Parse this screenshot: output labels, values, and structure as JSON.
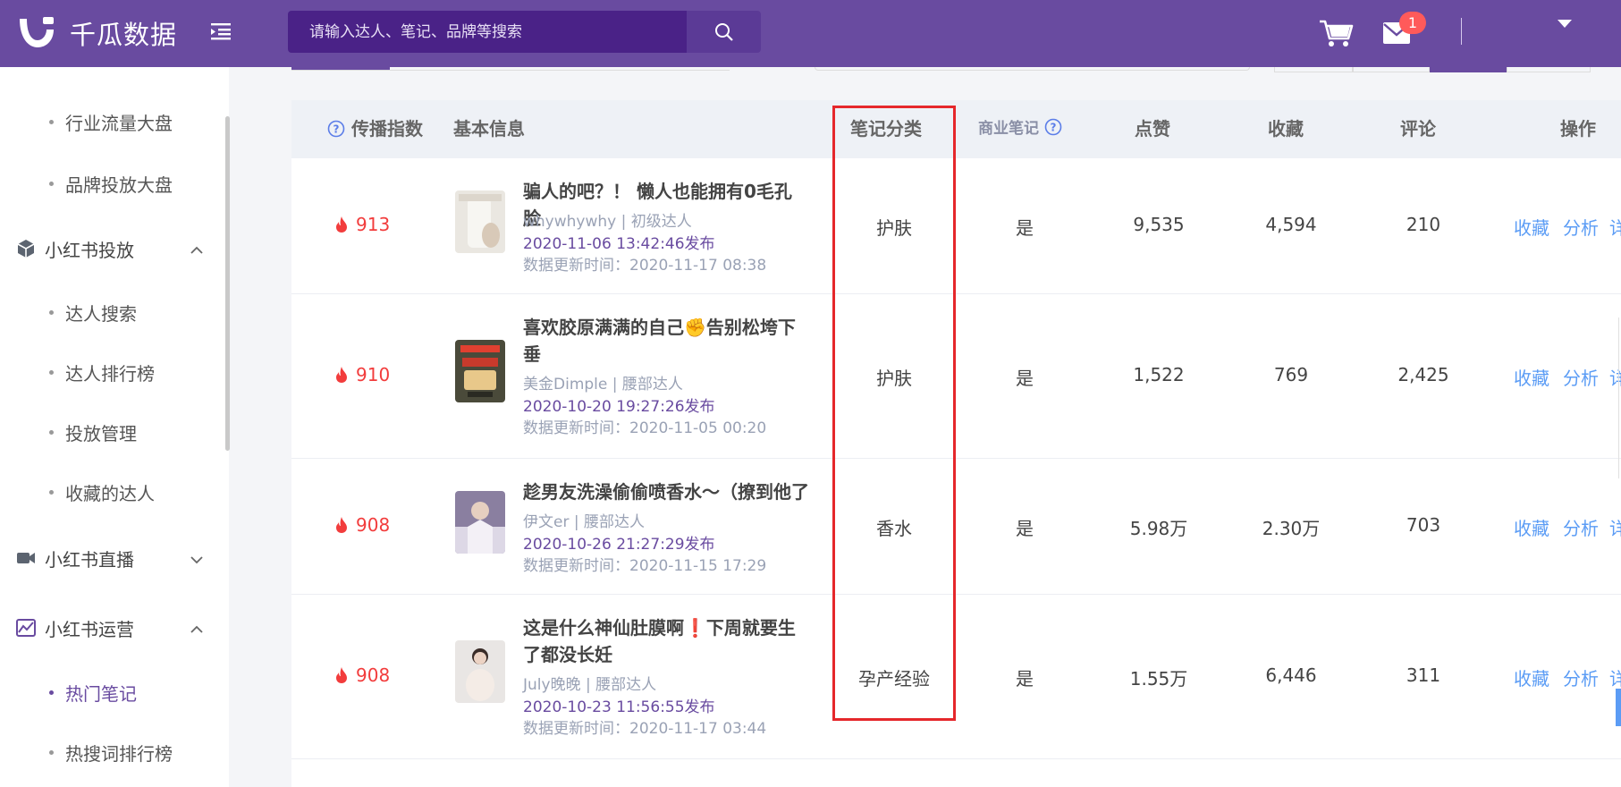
{
  "app": {
    "logo_text": "千瓜数据"
  },
  "header": {
    "search_placeholder": "请输入达人、笔记、品牌等搜索",
    "mail_badge": "1",
    "brand_color": "#694ba0"
  },
  "sidebar": {
    "top_items": [
      {
        "label": "行业流量大盘"
      },
      {
        "label": "品牌投放大盘"
      }
    ],
    "groups": [
      {
        "label": "小红书投放",
        "icon": "cube-icon",
        "expanded": true,
        "items": [
          {
            "label": "达人搜索"
          },
          {
            "label": "达人排行榜"
          },
          {
            "label": "投放管理"
          },
          {
            "label": "收藏的达人"
          }
        ]
      },
      {
        "label": "小红书直播",
        "icon": "video-icon",
        "expanded": false,
        "items": []
      },
      {
        "label": "小红书运营",
        "icon": "chart-icon",
        "expanded": true,
        "items": [
          {
            "label": "热门笔记",
            "active": true
          },
          {
            "label": "热搜词排行榜"
          }
        ]
      }
    ]
  },
  "table": {
    "columns": {
      "spread": "传播指数",
      "basic": "基本信息",
      "category": "笔记分类",
      "commercial": "商业笔记",
      "likes": "点赞",
      "collects": "收藏",
      "comments": "评论",
      "actions": "操作"
    },
    "rows": [
      {
        "spread": "913",
        "title": "骗人的吧？！ 懒人也能拥有0毛孔脸",
        "author": "whywhywhy | 初级达人",
        "publish": "2020-11-06 13:42:46发布",
        "updated": "数据更新时间：2020-11-17 08:38",
        "category": "护肤",
        "commercial": "是",
        "likes": "9,535",
        "collects": "4,594",
        "comments": "210"
      },
      {
        "spread": "910",
        "title": "喜欢胶原满满的自己✊告别松垮下垂",
        "author": "美金Dimple | 腰部达人",
        "publish": "2020-10-20 19:27:26发布",
        "updated": "数据更新时间：2020-11-05 00:20",
        "category": "护肤",
        "commercial": "是",
        "likes": "1,522",
        "collects": "769",
        "comments": "2,425"
      },
      {
        "spread": "908",
        "title": "趁男友洗澡偷偷喷香水～（撩到他了",
        "author": "伊文er | 腰部达人",
        "publish": "2020-10-26 21:27:29发布",
        "updated": "数据更新时间：2020-11-15 17:29",
        "category": "香水",
        "commercial": "是",
        "likes": "5.98万",
        "collects": "2.30万",
        "comments": "703"
      },
      {
        "spread": "908",
        "title": "这是什么神仙肚膜啊❗下周就要生了都没长妊",
        "author": "July晚晚 | 腰部达人",
        "publish": "2020-10-23 11:56:55发布",
        "updated": "数据更新时间：2020-11-17 03:44",
        "category": "孕产经验",
        "commercial": "是",
        "likes": "1.55万",
        "collects": "6,446",
        "comments": "311"
      }
    ],
    "actions": {
      "collect": "收藏",
      "analyze": "分析",
      "detail": "详"
    }
  }
}
